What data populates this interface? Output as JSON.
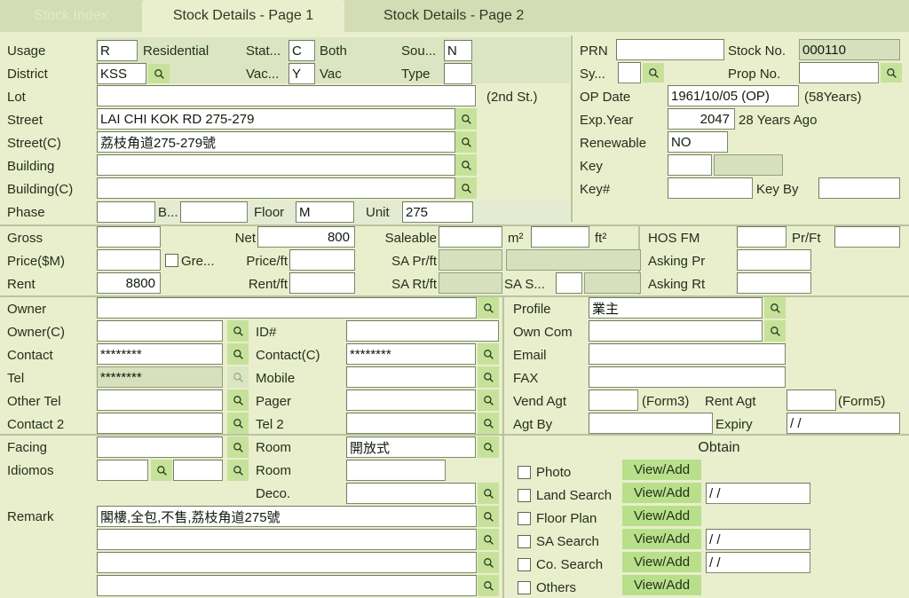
{
  "tabs": [
    {
      "label": "Stock Index",
      "state": "disabled"
    },
    {
      "label": "Stock Details - Page 1",
      "state": "active"
    },
    {
      "label": "Stock Details - Page 2",
      "state": "inactive"
    }
  ],
  "left": {
    "usage_label": "Usage",
    "usage_code": "R",
    "usage_text": "Residential",
    "status_label": "Stat...",
    "status_code": "C",
    "status_text": "Both",
    "source_label": "Sou...",
    "source_code": "N",
    "district_label": "District",
    "district_code": "KSS",
    "vacant_label": "Vac...",
    "vacant_code": "Y",
    "vacant_text": "Vac",
    "type_label": "Type",
    "type_code": "",
    "lot_label": "Lot",
    "lot_value": "",
    "second_st": "(2nd St.)",
    "street_label": "Street",
    "street_value": "LAI CHI KOK RD 275-279",
    "street_c_label": "Street(C)",
    "street_c_value": "荔枝角道275-279號",
    "building_label": "Building",
    "building_value": "",
    "building_c_label": "Building(C)",
    "building_c_value": "",
    "phase_label": "Phase",
    "phase_value": "",
    "block_label": "B...",
    "block_value": "",
    "floor_label": "Floor",
    "floor_value": "M",
    "unit_label": "Unit",
    "unit_value": "275"
  },
  "right_top": {
    "prn_label": "PRN",
    "prn_value": "",
    "stock_no_label": "Stock No.",
    "stock_no_value": "000110",
    "sy_label": "Sy...",
    "sy_value": "",
    "prop_no_label": "Prop No.",
    "prop_no_value": "",
    "op_date_label": "OP Date",
    "op_date_value": "1961/10/05 (OP)",
    "op_age": "(58Years)",
    "exp_year_label": "Exp.Year",
    "exp_year_value": "2047",
    "exp_note": "28 Years Ago",
    "renewable_label": "Renewable",
    "renewable_value": "NO",
    "key_label": "Key",
    "key_value": "",
    "key_no_label": "Key#",
    "key_no_value": "",
    "key_by_label": "Key By",
    "key_by_value": ""
  },
  "area": {
    "gross_label": "Gross",
    "gross_value": "",
    "net_label": "Net",
    "net_value": "800",
    "saleable_label": "Saleable",
    "saleable_value": "",
    "m2_label": "m²",
    "m2_value": "",
    "ft2_label": "ft²",
    "hos_fm_label": "HOS FM",
    "hos_fm_value": "",
    "pr_ft_label": "Pr/Ft",
    "pr_ft_value": "",
    "price_label": "Price($M)",
    "price_value": "",
    "gre_label": "Gre...",
    "gre_checked": false,
    "price_ft_label": "Price/ft",
    "price_ft_value": "",
    "sa_pr_ft_label": "SA Pr/ft",
    "sa_pr_ft_value": "",
    "sa_pr_ft_value2": "",
    "asking_pr_label": "Asking Pr",
    "asking_pr_value": "",
    "rent_label": "Rent",
    "rent_value": "8800",
    "rent_ft_label": "Rent/ft",
    "rent_ft_value": "",
    "sa_rt_ft_label": "SA Rt/ft",
    "sa_rt_ft_value": "",
    "sa_s_label": "SA S...",
    "sa_s_value": "",
    "asking_rt_label": "Asking Rt",
    "asking_rt_value": ""
  },
  "contact": {
    "owner_label": "Owner",
    "owner_value": "",
    "owner_c_label": "Owner(C)",
    "owner_c_value": "",
    "id_label": "ID#",
    "id_value": "",
    "contact_label": "Contact",
    "contact_value": "********",
    "contact_c_label": "Contact(C)",
    "contact_c_value": "********",
    "tel_label": "Tel",
    "tel_value": "********",
    "mobile_label": "Mobile",
    "mobile_value": "",
    "other_tel_label": "Other Tel",
    "other_tel_value": "",
    "pager_label": "Pager",
    "pager_value": "",
    "contact2_label": "Contact 2",
    "contact2_value": "",
    "tel2_label": "Tel 2",
    "tel2_value": ""
  },
  "agent": {
    "profile_label": "Profile",
    "profile_value": "業主",
    "own_com_label": "Own Com",
    "own_com_value": "",
    "email_label": "Email",
    "email_value": "",
    "fax_label": "FAX",
    "fax_value": "",
    "vend_agt_label": "Vend Agt",
    "vend_agt_value": "",
    "form3_label": "(Form3)",
    "rent_agt_label": "Rent Agt",
    "rent_agt_value": "",
    "form5_label": "(Form5)",
    "agt_by_label": "Agt By",
    "agt_by_value": "",
    "expiry_label": "Expiry",
    "expiry_value": "/  /"
  },
  "features": {
    "facing_label": "Facing",
    "facing_value": "",
    "room_label": "Room",
    "room_value": "開放式",
    "idiomos_label": "Idiomos",
    "idiomos_value1": "",
    "idiomos_value2": "",
    "room2_label": "Room",
    "room2_value": "",
    "deco_label": "Deco.",
    "deco_value": "",
    "remark_label": "Remark",
    "remark_lines": [
      "閣樓,全包,不售,荔枝角道275號",
      "",
      "",
      ""
    ]
  },
  "obtain": {
    "title": "Obtain",
    "rows": [
      {
        "label": "Photo",
        "checked": false,
        "button": "View/Add",
        "date": null
      },
      {
        "label": "Land Search",
        "checked": false,
        "button": "View/Add",
        "date": "/  /"
      },
      {
        "label": "Floor Plan",
        "checked": false,
        "button": "View/Add",
        "date": null
      },
      {
        "label": "SA Search",
        "checked": false,
        "button": "View/Add",
        "date": "/  /"
      },
      {
        "label": "Co. Search",
        "checked": false,
        "button": "View/Add",
        "date": "/  /"
      },
      {
        "label": "Others",
        "checked": false,
        "button": "View/Add",
        "date": null
      }
    ]
  },
  "icons": {
    "search": "search-icon"
  },
  "colors": {
    "page_bg": "#e9eecd",
    "tabbar_bg": "#d3dcb4",
    "field_bg": "#ffffff",
    "readonly_bg": "#d7e0bc",
    "search_btn": "#c6e29a",
    "action_btn": "#b8e08a",
    "text": "#23301b"
  }
}
